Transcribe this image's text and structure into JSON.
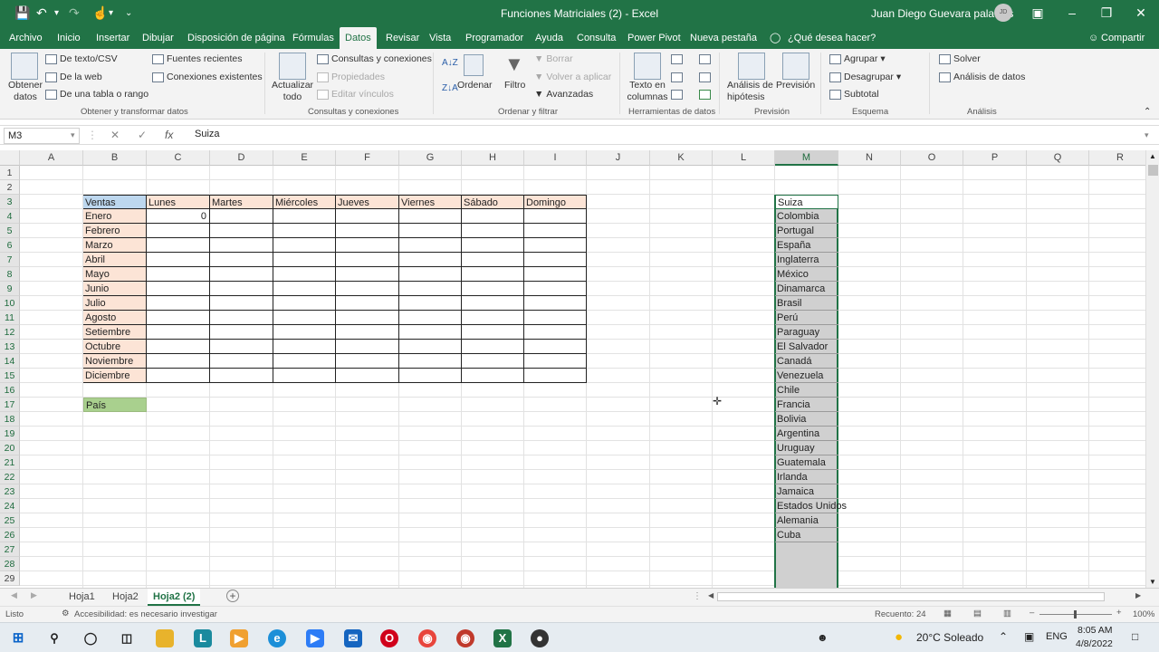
{
  "window": {
    "title": "Funciones Matriciales (2)  -  Excel",
    "user": "Juan Diego Guevara palacios",
    "user_initials": "JD"
  },
  "menu": {
    "tabs": [
      "Archivo",
      "Inicio",
      "Insertar",
      "Dibujar",
      "Disposición de página",
      "Fórmulas",
      "Datos",
      "Revisar",
      "Vista",
      "Programador",
      "Ayuda",
      "Consulta",
      "Power Pivot",
      "Nueva pestaña"
    ],
    "tell_me": "¿Qué desea hacer?",
    "share": "Compartir"
  },
  "ribbon": {
    "obtener": {
      "big": "Obtener\ndatos",
      "from_text": "De texto/CSV",
      "from_web": "De la web",
      "from_table": "De una tabla o rango",
      "recent": "Fuentes recientes",
      "existing": "Conexiones existentes",
      "label": "Obtener y transformar datos"
    },
    "consultas": {
      "refresh": "Actualizar\ntodo",
      "queries": "Consultas y conexiones",
      "props": "Propiedades",
      "edit_links": "Editar vínculos",
      "label": "Consultas y conexiones"
    },
    "ordenar": {
      "sort": "Ordenar",
      "filter": "Filtro",
      "clear": "Borrar",
      "reapply": "Volver a aplicar",
      "advanced": "Avanzadas",
      "label": "Ordenar y filtrar"
    },
    "herramientas": {
      "text_to_cols": "Texto en\ncolumnas",
      "label": "Herramientas de datos"
    },
    "prevision": {
      "whatif": "Análisis de\nhipótesis",
      "forecast": "Previsión",
      "label": "Previsión"
    },
    "esquema": {
      "group": "Agrupar",
      "ungroup": "Desagrupar",
      "subtotal": "Subtotal",
      "label": "Esquema"
    },
    "analisis": {
      "solver": "Solver",
      "data_analysis": "Análisis de datos",
      "label": "Análisis"
    }
  },
  "formula_bar": {
    "name_box": "M3",
    "value": "Suiza"
  },
  "sheet": {
    "columns": [
      "A",
      "B",
      "C",
      "D",
      "E",
      "F",
      "G",
      "H",
      "I",
      "J",
      "K",
      "L",
      "M",
      "N",
      "O",
      "P",
      "Q",
      "R"
    ],
    "rows": [
      "1",
      "2",
      "3",
      "4",
      "5",
      "6",
      "7",
      "8",
      "9",
      "10",
      "11",
      "12",
      "13",
      "14",
      "15",
      "16",
      "17",
      "18",
      "19",
      "20",
      "21",
      "22",
      "23",
      "24",
      "25",
      "26",
      "27",
      "28",
      "29"
    ],
    "table_header": [
      "Ventas",
      "Lunes",
      "Martes",
      "Miércoles",
      "Jueves",
      "Viernes",
      "Sábado",
      "Domingo"
    ],
    "months": [
      "Enero",
      "Febrero",
      "Marzo",
      "Abril",
      "Mayo",
      "Junio",
      "Julio",
      "Agosto",
      "Setiembre",
      "Octubre",
      "Noviembre",
      "Diciembre"
    ],
    "c4_value": "0",
    "pais_label": "País",
    "countries": [
      "Suiza",
      "Colombia",
      "Portugal",
      "España",
      "Inglaterra",
      "México",
      "Dinamarca",
      "Brasil",
      "Perú",
      "Paraguay",
      "El Salvador",
      "Canadá",
      "Venezuela",
      "Chile",
      "Francia",
      "Bolivia",
      "Argentina",
      "Uruguay",
      "Guatemala",
      "Irlanda",
      "Jamaica",
      "Estados Unidos",
      "Alemania",
      "Cuba"
    ]
  },
  "sheet_tabs": [
    "Hoja1",
    "Hoja2",
    "Hoja2 (2)"
  ],
  "active_sheet_tab": "Hoja2 (2)",
  "status": {
    "ready": "Listo",
    "accessibility": "Accesibilidad: es necesario investigar",
    "count": "Recuento: 24",
    "zoom": "100%"
  },
  "taskbar": {
    "weather": "20°C  Soleado",
    "lang": "ENG",
    "time": "8:05 AM",
    "date": "4/8/2022"
  },
  "colors": {
    "excel_green": "#217346",
    "header_blue": "#bdd7ee",
    "month_peach": "#fce4d6",
    "pais_green": "#a9d08e",
    "selection_gray": "#d0d0d0"
  }
}
